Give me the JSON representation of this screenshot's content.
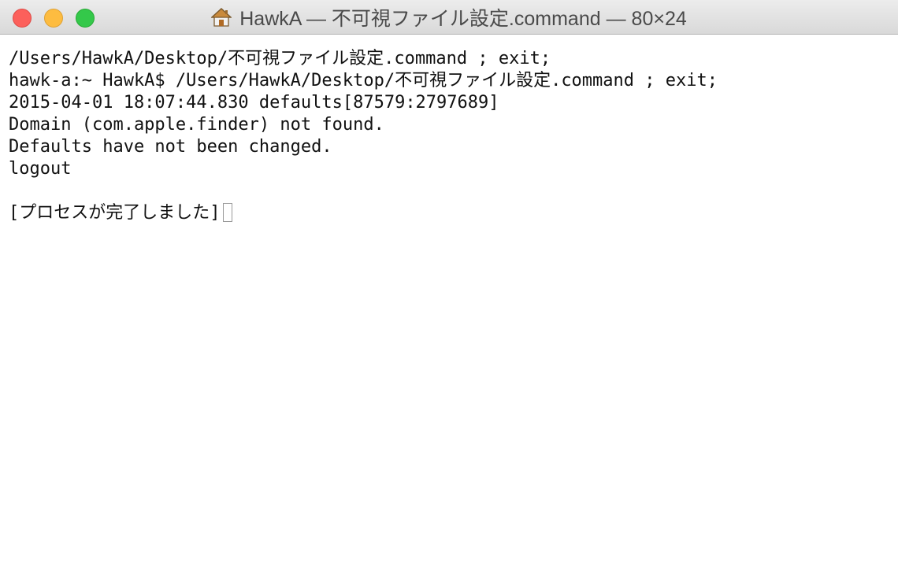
{
  "window": {
    "title": "HawkA — 不可視ファイル設定.command — 80×24",
    "title_icon": "home-folder-icon",
    "controls": {
      "close_color": "#fc605b",
      "minimize_color": "#fdbc40",
      "zoom_color": "#34c84a"
    }
  },
  "terminal": {
    "lines": [
      "/Users/HawkA/Desktop/不可視ファイル設定.command ; exit;",
      "hawk-a:~ HawkA$ /Users/HawkA/Desktop/不可視ファイル設定.command ; exit;",
      "2015-04-01 18:07:44.830 defaults[87579:2797689]",
      "Domain (com.apple.finder) not found.",
      "Defaults have not been changed.",
      "logout",
      "",
      "[プロセスが完了しました]"
    ],
    "cursor": "block-cursor"
  }
}
